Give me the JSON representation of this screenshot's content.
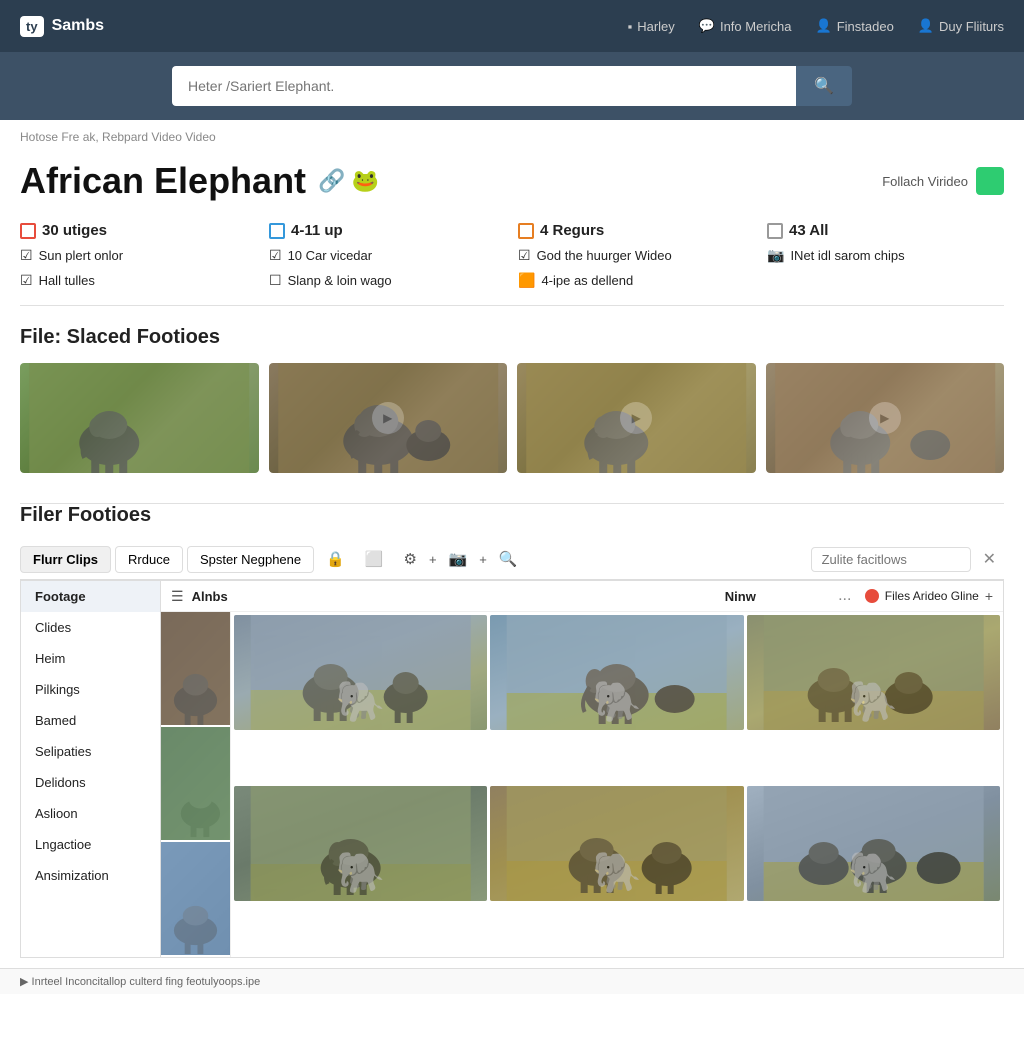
{
  "header": {
    "logo_text": "ty",
    "brand_name": "Sambs",
    "nav": [
      {
        "label": "Harley",
        "icon": "▪"
      },
      {
        "label": "Info Mericha",
        "icon": "💬"
      },
      {
        "label": "Finstadeo",
        "icon": "👤"
      },
      {
        "label": "Duy Fliiturs",
        "icon": "👤"
      }
    ]
  },
  "search": {
    "placeholder": "Heter /Sariert Elephant.",
    "button_icon": "🔍"
  },
  "breadcrumb": "Hotose Fre ak, Rebpard Video Video",
  "page_title": "African Elephant",
  "title_icons": [
    "🔗",
    "🐸"
  ],
  "follow_label": "Follach Virideo",
  "filters": [
    {
      "badge": "30 utiges",
      "badge_color": "red",
      "checks": [
        "Sun plert onlor",
        "Hall tulles"
      ]
    },
    {
      "badge": "4-11 up",
      "badge_color": "blue",
      "checks": [
        "10 Car vicedar",
        "Slanp & loin wago"
      ]
    },
    {
      "badge": "4 Regurs",
      "badge_color": "orange",
      "checks": [
        "God the huurger Wideo",
        "4-ipe as dellend"
      ]
    },
    {
      "badge": "43 All",
      "badge_color": "gray",
      "checks": [
        "INet idl sarom chips"
      ]
    }
  ],
  "file_section_title": "File: Slaced Footioes",
  "video_thumbs": [
    {
      "id": 1,
      "scene_class": "scene1"
    },
    {
      "id": 2,
      "scene_class": "scene2",
      "has_play": true
    },
    {
      "id": 3,
      "scene_class": "scene3",
      "has_play": true
    },
    {
      "id": 4,
      "scene_class": "scene4",
      "has_play": true
    }
  ],
  "filer_section_title": "Filer Footioes",
  "toolbar": {
    "tabs": [
      "Flurr Clips",
      "Rrduce",
      "Spster Negphene"
    ],
    "active_tab": "Flurr Clips",
    "icons": [
      "🔒",
      "⬜",
      "⚙",
      "+",
      "📷",
      "+",
      "🔍"
    ],
    "search_placeholder": "Zulite facitlows",
    "close_icon": "✕"
  },
  "sidebar": {
    "items": [
      "Footage",
      "Clides",
      "Heim",
      "Pilkings",
      "Bamed",
      "Selipaties",
      "Delidons",
      "Aslioon",
      "Lngactioe",
      "Ansimization"
    ],
    "active": "Footage"
  },
  "grid_header": {
    "col1": "Alnbs",
    "col2": "Ninw",
    "dots": "...",
    "files_label": "Files Arideo Gline",
    "plus": "+"
  },
  "image_grid": [
    {
      "class": "lt1",
      "row": 1
    },
    {
      "class": "lt2",
      "row": 2
    },
    {
      "class": "lt3",
      "row": 3
    }
  ],
  "image_cells": [
    {
      "class": "es1"
    },
    {
      "class": "es2"
    },
    {
      "class": "es3"
    },
    {
      "class": "es4"
    },
    {
      "class": "es5"
    },
    {
      "class": "es6"
    }
  ],
  "bottom_bar": "▶ Inrteel Inconcitallop culterd fing feotulyoops.ipe"
}
